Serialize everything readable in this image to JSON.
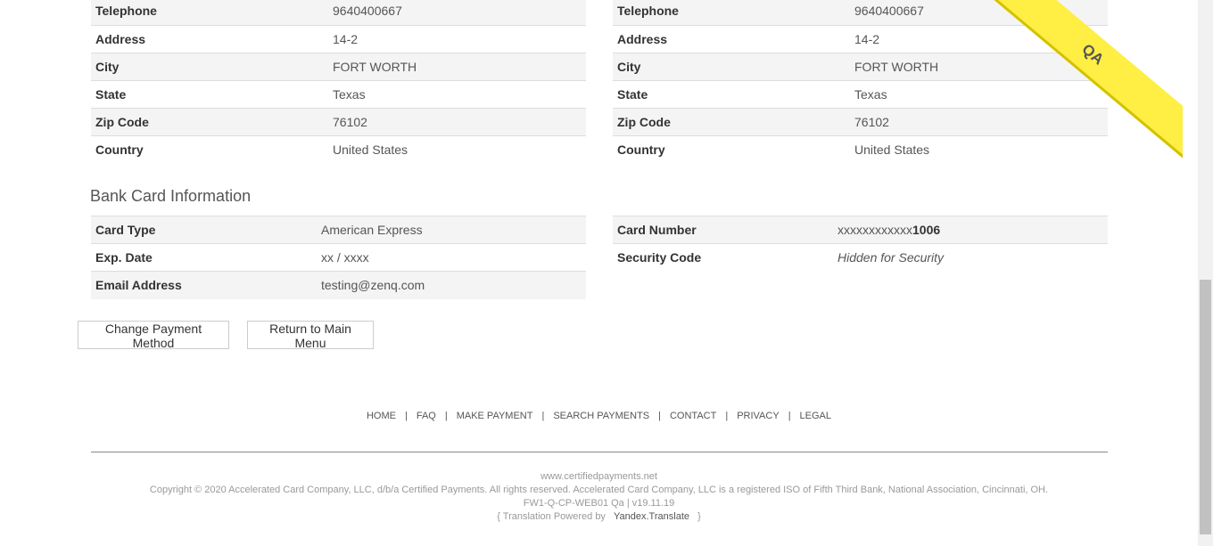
{
  "address_left": [
    {
      "label": "Telephone",
      "value": "9640400667"
    },
    {
      "label": "Address",
      "value": "14-2"
    },
    {
      "label": "City",
      "value": "FORT WORTH"
    },
    {
      "label": "State",
      "value": "Texas"
    },
    {
      "label": "Zip Code",
      "value": "76102"
    },
    {
      "label": "Country",
      "value": "United States"
    }
  ],
  "address_right": [
    {
      "label": "Telephone",
      "value": "9640400667"
    },
    {
      "label": "Address",
      "value": "14-2"
    },
    {
      "label": "City",
      "value": "FORT WORTH"
    },
    {
      "label": "State",
      "value": "Texas"
    },
    {
      "label": "Zip Code",
      "value": "76102"
    },
    {
      "label": "Country",
      "value": "United States"
    }
  ],
  "bank_card": {
    "title": "Bank Card Information",
    "left": [
      {
        "label": "Card Type",
        "value": "American Express"
      },
      {
        "label": "Exp. Date",
        "value": "xx / xxxx"
      },
      {
        "label": "Email Address",
        "value": "testing@zenq.com"
      }
    ],
    "card_number_label": "Card Number",
    "card_number_mask": "xxxxxxxxxxxx",
    "card_number_last4": "1006",
    "security_label": "Security Code",
    "security_value": "Hidden for Security"
  },
  "buttons": {
    "change_payment": "Change Payment Method",
    "return_main": "Return to Main Menu"
  },
  "footer": {
    "nav": [
      "HOME",
      "FAQ",
      "MAKE PAYMENT",
      "SEARCH PAYMENTS",
      "CONTACT",
      "PRIVACY",
      "LEGAL"
    ],
    "site": "www.certifiedpayments.net",
    "copyright": "Copyright © 2020 Accelerated Card Company, LLC, d/b/a Certified Payments. All rights reserved. Accelerated Card Company, LLC is a registered ISO of Fifth Third Bank, National Association, Cincinnati, OH.",
    "version": "FW1-Q-CP-WEB01 Qa | v19.11.19",
    "translation_prefix": "{ Translation Powered by",
    "translation_link": "Yandex.Translate",
    "translation_suffix": "}"
  },
  "ribbon": {
    "label": "QA",
    "color": "#ffee44"
  }
}
